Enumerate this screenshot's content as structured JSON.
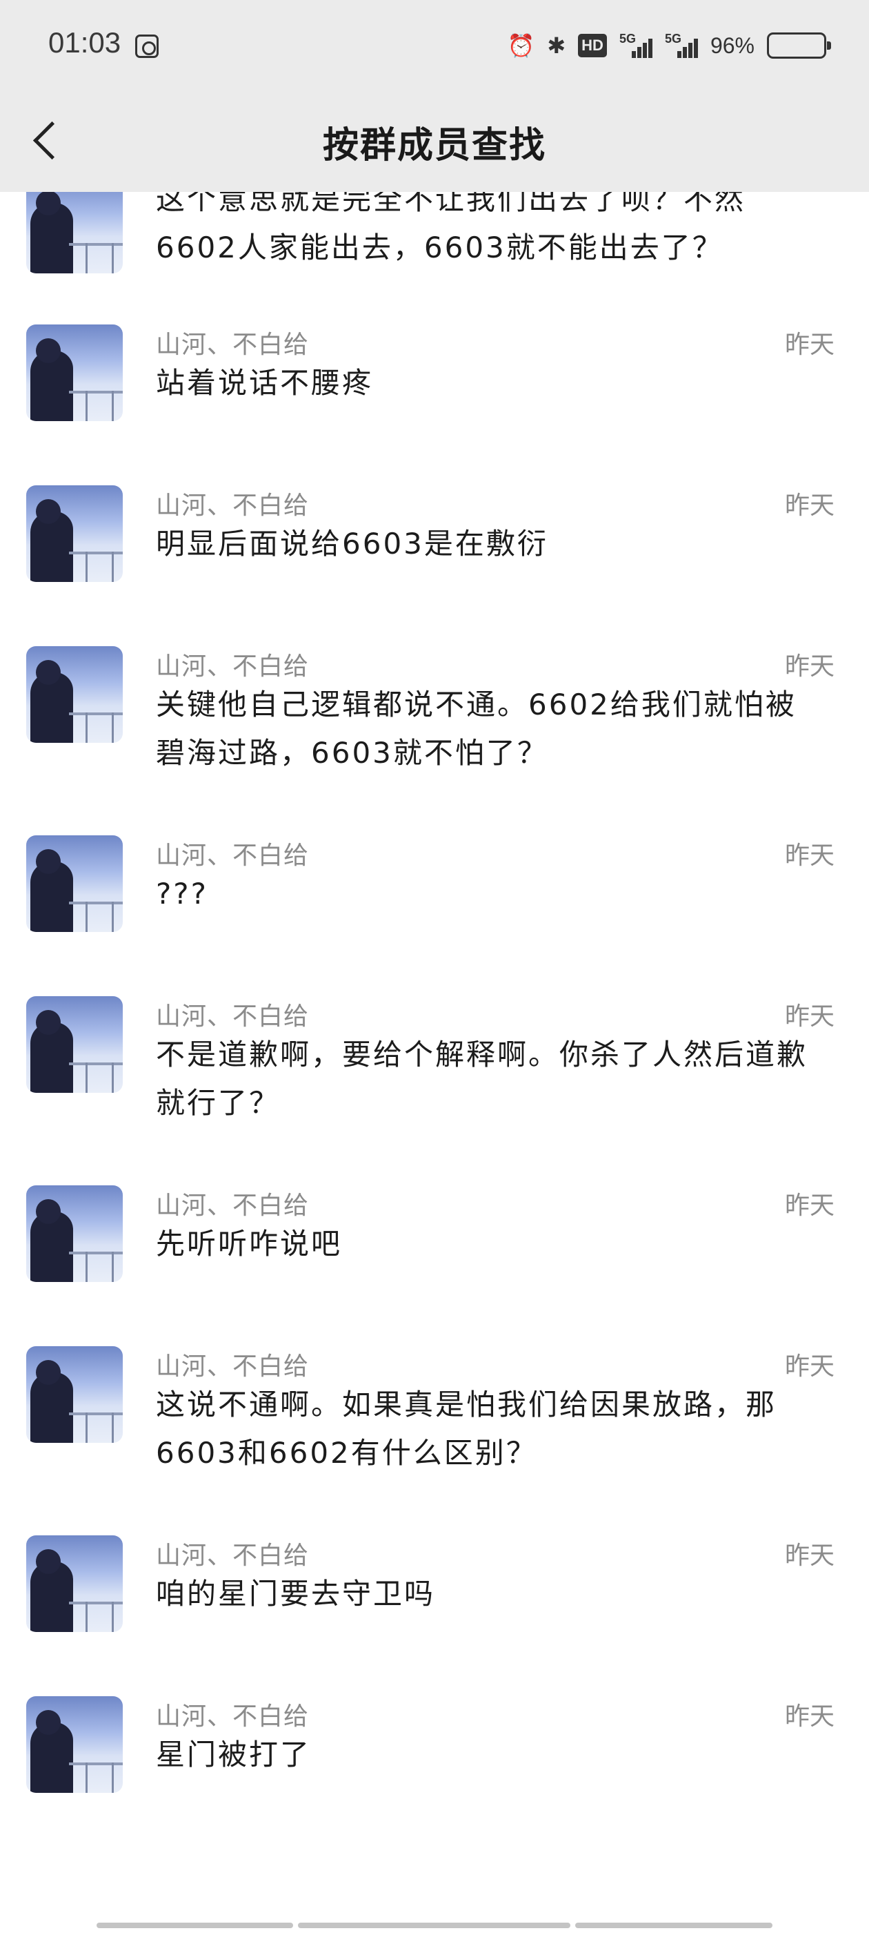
{
  "status_bar": {
    "time": "01:03",
    "battery_percent": "96%",
    "network_label": "5G",
    "battery_color": "#ff6f96"
  },
  "header": {
    "title": "按群成员查找"
  },
  "first_message": {
    "line1": "这个意思就是完全不让我们出去了呗？不然",
    "line2": "6602人家能出去，6603就不能出去了？"
  },
  "messages": [
    {
      "sender": "山河、不白给",
      "time": "昨天",
      "text": "站着说话不腰疼"
    },
    {
      "sender": "山河、不白给",
      "time": "昨天",
      "text": "明显后面说给6603是在敷衍"
    },
    {
      "sender": "山河、不白给",
      "time": "昨天",
      "text": "关键他自己逻辑都说不通。6602给我们就怕被碧海过路，6603就不怕了？"
    },
    {
      "sender": "山河、不白给",
      "time": "昨天",
      "text": "???"
    },
    {
      "sender": "山河、不白给",
      "time": "昨天",
      "text": "不是道歉啊，要给个解释啊。你杀了人然后道歉就行了？"
    },
    {
      "sender": "山河、不白给",
      "time": "昨天",
      "text": "先听听咋说吧"
    },
    {
      "sender": "山河、不白给",
      "time": "昨天",
      "text": "这说不通啊。如果真是怕我们给因果放路，那6603和6602有什么区别？"
    },
    {
      "sender": "山河、不白给",
      "time": "昨天",
      "text": "咱的星门要去守卫吗"
    },
    {
      "sender": "山河、不白给",
      "time": "昨天",
      "text": "星门被打了"
    }
  ]
}
